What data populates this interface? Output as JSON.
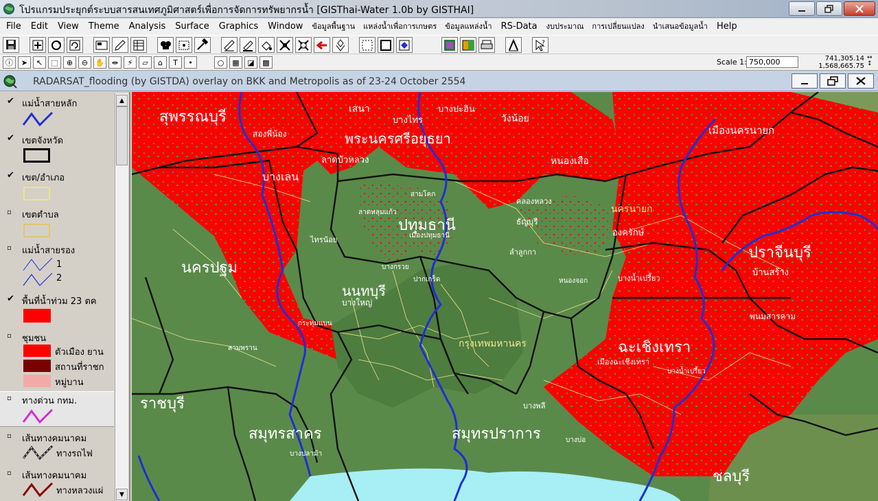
{
  "window": {
    "title": "โปรแกรมประยุกต์ระบบสารสนเทศภูมิศาสตร์เพื่อการจัดการทรัพยากรน้ำ  [GISThai-Water 1.0b   by GISTHAI]"
  },
  "menu": [
    "File",
    "Edit",
    "View",
    "Theme",
    "Analysis",
    "Surface",
    "Graphics",
    "Window",
    "ข้อมูลพื้นฐาน",
    "แหล่งน้ำเพื่อการเกษตร",
    "ข้อมูลแหล่งน้ำ",
    "RS-Data",
    "งบประมาณ",
    "การเปลี่ยนแปลง",
    "นำเสนอข้อมูลน้ำ",
    "Help"
  ],
  "scale": {
    "label": "Scale 1:",
    "value": "750,000"
  },
  "coords": {
    "x": "741,305.14",
    "y": "1,568,665.75"
  },
  "view": {
    "title": "RADARSAT_flooding (by GISTDA) overlay on BKK and Metropolis as of 23-24 October 2554"
  },
  "toc": {
    "layers": [
      {
        "name": "แม่น้ำสายหลัก",
        "checked": true
      },
      {
        "name": "เขตจังหวัด",
        "checked": true
      },
      {
        "name": "เขต/อำเภอ",
        "checked": true
      },
      {
        "name": "เขตตำบล",
        "checked": false
      },
      {
        "name": "แม่น้ำสายรอง",
        "checked": false,
        "items": [
          "1",
          "2"
        ]
      },
      {
        "name": "พื้นที่น้ำท่วม 23 ตค",
        "checked": true
      },
      {
        "name": "ชุมชน",
        "checked": false,
        "items": [
          "ตัวเมือง ยาน",
          "สถานที่ราชก",
          "หมู่บาน"
        ]
      },
      {
        "name": "ทางด่วน กทม.",
        "checked": false
      },
      {
        "name": "เส้นทางคมนาคม",
        "checked": false,
        "items": [
          "ทางรถไฟ"
        ]
      },
      {
        "name": "เส้นทางคมนาคม",
        "checked": false,
        "items": [
          "ทางหลวงแผ่"
        ]
      }
    ],
    "check_glyph": "✔"
  },
  "map": {
    "province_labels": [
      "สุพรรณบุรี",
      "พระนครศรีอยุธยา",
      "นครปฐม",
      "ปทุมธานี",
      "นนทบุรี",
      "ปราจีนบุรี",
      "ฉะเชิงเทรา",
      "ราชบุรี",
      "สมุทรสาคร",
      "สมุทรปราการ",
      "ชลบุรี",
      "นครนายก",
      "กรุงเทพมหานคร"
    ],
    "district_labels": [
      "บางเลน",
      "ลาดบัวหลวง",
      "หนองเสือ",
      "วังน้อย",
      "เสนา",
      "บางไทร",
      "บางปะอิน",
      "สองพี่น้อง",
      "เมืองนครนายก",
      "องครักษ์",
      "บ้านสร้าง",
      "บางน้ำเปรี้ยว",
      "ธัญบุรี",
      "คลองหลวง",
      "ลำลูกกา",
      "ไทรน้อย",
      "บางใหญ่",
      "บางพลี",
      "เมืองฉะเชิงเทรา",
      "บางบ่อ",
      "สามโคก",
      "เมืองปทุมธานี",
      "บางปลาม้า",
      "ปากเกร็ด",
      "กระทุ่มแบน",
      "ลาดหลุมแก้ว",
      "บางกรวย",
      "หนองจอก",
      "บางน้ำเปรี้ยว",
      "พนมสารคาม",
      "สามพราน"
    ]
  },
  "colors": {
    "flood": "#ff0000",
    "land": "#5a8a4a",
    "river": "#1f2fd6",
    "district_border": "#f0e68c",
    "province_border": "#111111",
    "sea": "#a8eef5"
  }
}
